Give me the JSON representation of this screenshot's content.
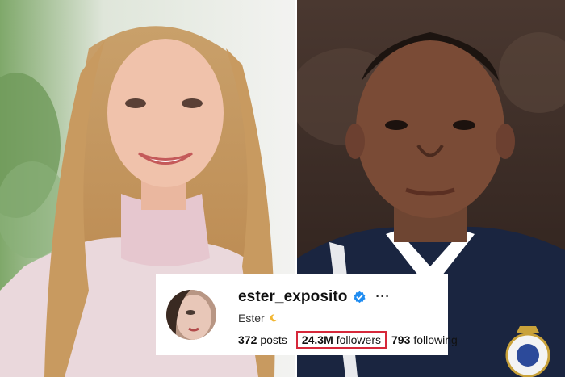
{
  "profile": {
    "username": "ester_exposito",
    "display_name": "Ester",
    "display_name_emoji_icon": "crescent-moon-icon",
    "verified_icon": "verified-badge-icon",
    "more_label": "···",
    "stats": {
      "posts_count": "372",
      "posts_label": "posts",
      "followers_count": "24.3M",
      "followers_label": "followers",
      "following_count": "793",
      "following_label": "following"
    }
  },
  "colors": {
    "verified_blue": "#1f8cf1",
    "highlight_red": "#d6283a",
    "right_bg": "#3a2a22",
    "jacket_navy": "#1a2540"
  }
}
